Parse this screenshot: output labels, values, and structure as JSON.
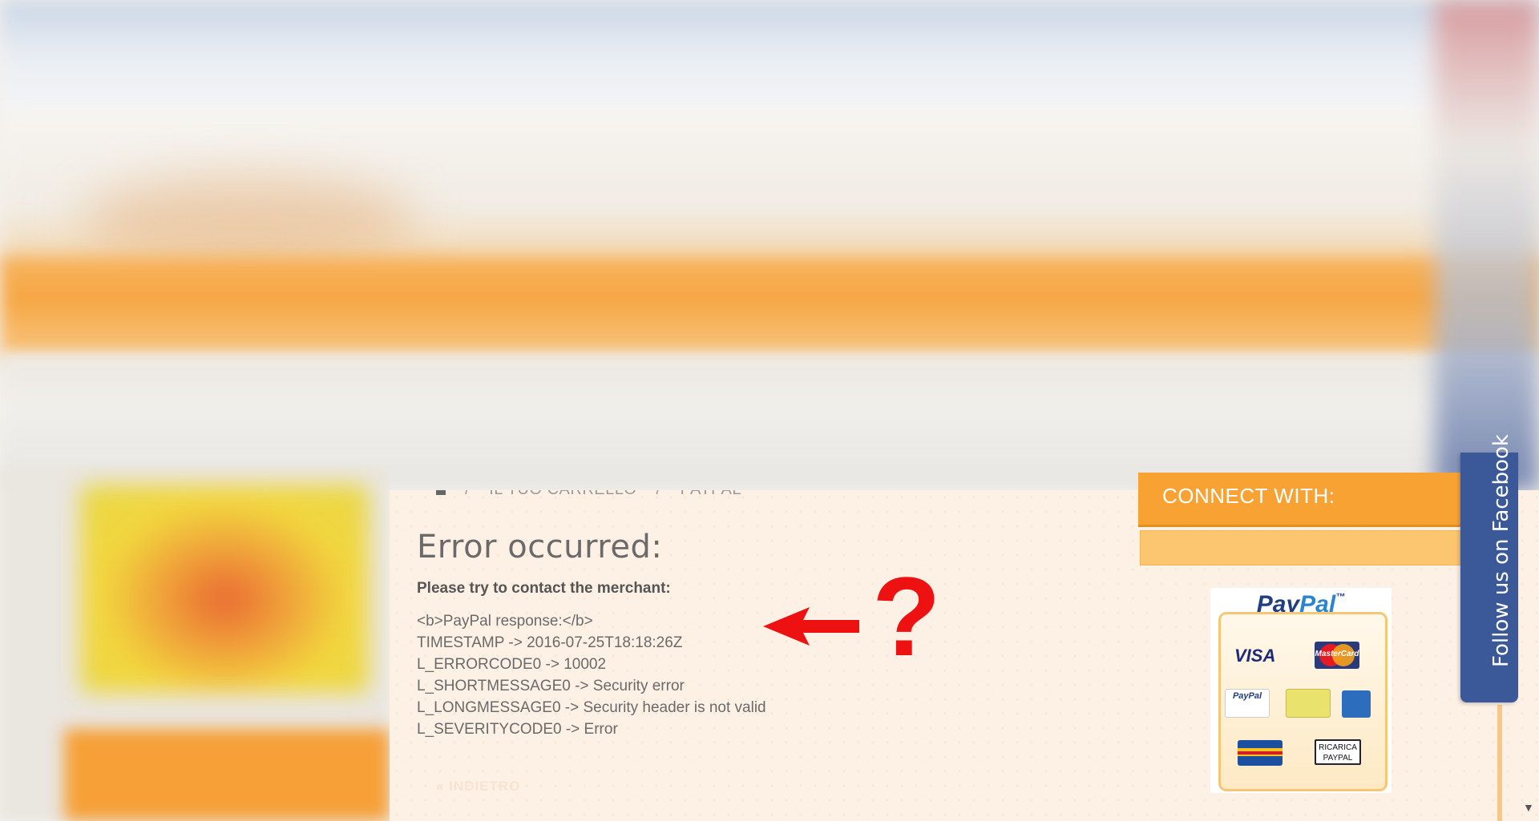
{
  "breadcrumb": {
    "items": [
      "IL TUO CARRELLO",
      "PAYPAL"
    ]
  },
  "error": {
    "title": "Error occurred:",
    "contact_message": "Please try to contact the merchant:",
    "response_lines": [
      "<b>PayPal response:</b>",
      "TIMESTAMP -> 2016-07-25T18:18:26Z",
      "L_ERRORCODE0 -> 10002",
      "L_SHORTMESSAGE0 -> Security error",
      "L_LONGMESSAGE0 -> Security header is not valid",
      "L_SEVERITYCODE0 -> Error"
    ],
    "back_link": "« INDIETRO"
  },
  "annotation": {
    "symbol": "?",
    "color": "#ee1111"
  },
  "sidebar": {
    "connect_title": "CONNECT WITH:",
    "paypal": {
      "logo_pay": "Pay",
      "logo_pal": "Pal",
      "logo_tm": "™",
      "visa": "VISA",
      "mastercard": "MasterCard",
      "paypal_small": "PayPal",
      "ricarica_line1": "RICARICA",
      "ricarica_line2": "PAYPAL"
    }
  },
  "facebook_tab": {
    "label": "Follow us on Facebook"
  },
  "colors": {
    "accent_orange": "#f7a233",
    "facebook_blue": "#3b5998",
    "panel_bg": "#fdf1e6"
  }
}
